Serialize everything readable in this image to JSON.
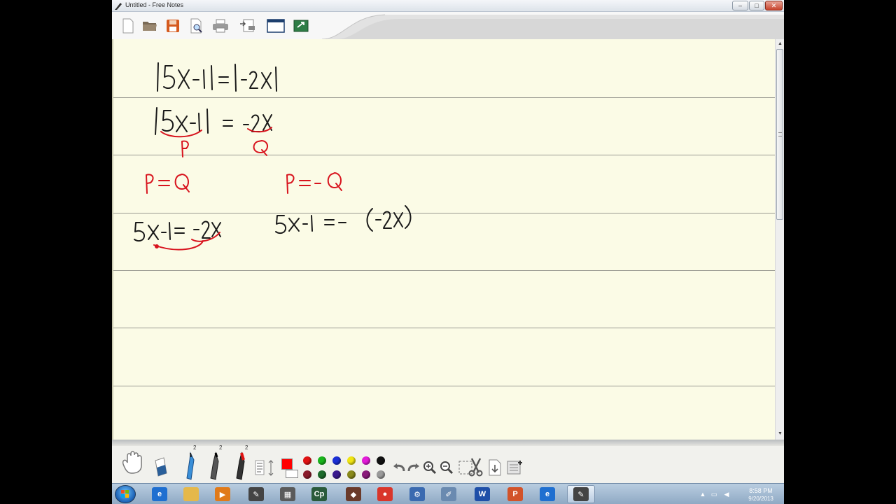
{
  "window": {
    "title": "Untitled - Free Notes",
    "minimize_glyph": "–",
    "maximize_glyph": "□",
    "close_glyph": "✕"
  },
  "toolbar": {
    "buttons": [
      {
        "name": "new-document-button",
        "icon": "blank-page-icon"
      },
      {
        "name": "open-folder-button",
        "icon": "folder-icon"
      },
      {
        "name": "save-button",
        "icon": "floppy-disk-icon"
      },
      {
        "name": "print-preview-button",
        "icon": "magnifier-page-icon"
      },
      {
        "name": "print-button",
        "icon": "printer-icon"
      },
      {
        "name": "page-setup-button",
        "icon": "page-setup-icon"
      },
      {
        "name": "window-view-button",
        "icon": "window-icon"
      },
      {
        "name": "export-button",
        "icon": "green-export-icon"
      }
    ]
  },
  "notes": {
    "ink_colors": {
      "black": "#1a1a1a",
      "red": "#d8141e"
    },
    "lines": [
      {
        "color": "black",
        "text": "|5X-1| = |-2X|"
      },
      {
        "color": "black",
        "text": "|5X-1| = -2X"
      },
      {
        "color": "red",
        "text": "P"
      },
      {
        "color": "red",
        "text": "Q"
      },
      {
        "color": "red",
        "text": "P = Q"
      },
      {
        "color": "red",
        "text": "P = -Q"
      },
      {
        "color": "black",
        "text": "5X-1 = -2X"
      },
      {
        "color": "black",
        "text": "5X-1 = - (-2X)"
      }
    ],
    "page_color": "#fbfbe6",
    "rule_color": "#9a9a92"
  },
  "palette": {
    "pen_sizes": [
      "2",
      "2",
      "2"
    ],
    "colors": {
      "row1": [
        "#e01212",
        "#19b51c",
        "#1b2fd6",
        "#f0e512",
        "#e31bd9",
        "#111111"
      ],
      "row2": [
        "#8a1a2a",
        "#1d6b2b",
        "#3a1a8e",
        "#8a8a1a",
        "#8a1a7a",
        "#9a9a9a"
      ]
    },
    "active_color": "#ff0000",
    "tools": [
      "hand-icon",
      "eraser-icon",
      "blue-pencil-icon",
      "black-marker-icon",
      "red-marker-icon",
      "text-align-icon",
      "undo-icon",
      "redo-icon",
      "zoom-in-icon",
      "zoom-out-icon",
      "select-icon",
      "scissors-icon",
      "insert-page-icon",
      "add-page-icon"
    ]
  },
  "taskbar": {
    "clock_time": "8:58 PM",
    "clock_date": "9/20/2013",
    "apps": [
      {
        "name": "ie",
        "glyph": "e",
        "color": "#1f6fd0"
      },
      {
        "name": "explorer",
        "glyph": "",
        "color": "#e5b84a"
      },
      {
        "name": "media-player",
        "glyph": "▶",
        "color": "#e07a1a"
      },
      {
        "name": "free-notes",
        "glyph": "✎",
        "color": "#444444"
      },
      {
        "name": "app-puzzle",
        "glyph": "▦",
        "color": "#5a5a5a"
      },
      {
        "name": "captivate",
        "glyph": "Cp",
        "color": "#2a5a3a"
      },
      {
        "name": "app-hat",
        "glyph": "◆",
        "color": "#6a3a2a"
      },
      {
        "name": "chrome",
        "glyph": "●",
        "color": "#d9362b"
      },
      {
        "name": "network",
        "glyph": "⚙",
        "color": "#3a6ab0"
      },
      {
        "name": "notepad",
        "glyph": "✐",
        "color": "#6a8ab0"
      },
      {
        "name": "word",
        "glyph": "W",
        "color": "#1f4fa8"
      },
      {
        "name": "powerpoint",
        "glyph": "P",
        "color": "#d2532a"
      },
      {
        "name": "ie-2",
        "glyph": "e",
        "color": "#1f6fd0"
      },
      {
        "name": "free-notes-2",
        "glyph": "✎",
        "color": "#444444"
      }
    ]
  }
}
